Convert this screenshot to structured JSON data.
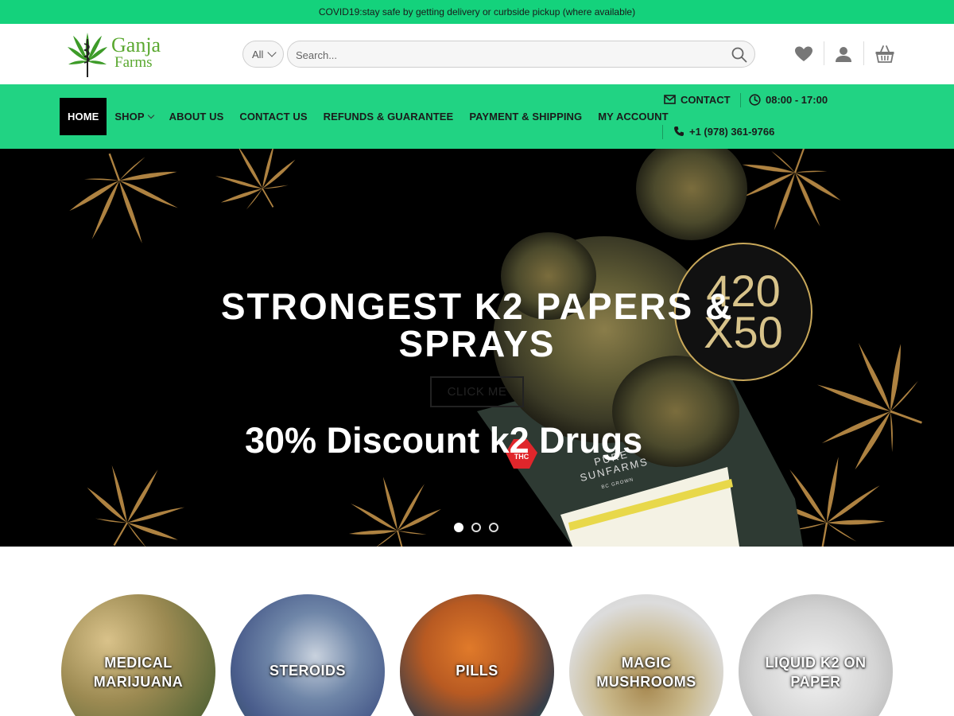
{
  "topbar": {
    "text": "COVID19:stay safe by getting delivery or curbside pickup (where available)"
  },
  "header": {
    "logo": {
      "line1": "Ganja",
      "line2": "Farms"
    },
    "category_select": {
      "value": "All"
    },
    "search": {
      "placeholder": "Search..."
    },
    "icons": [
      "heart-icon",
      "user-icon",
      "basket-icon"
    ]
  },
  "nav": {
    "items": [
      {
        "label": "HOME",
        "active": true
      },
      {
        "label": "SHOP",
        "dropdown": true
      },
      {
        "label": "ABOUT US"
      },
      {
        "label": "CONTACT US"
      },
      {
        "label": "REFUNDS & GUARANTEE"
      },
      {
        "label": "PAYMENT & SHIPPING"
      },
      {
        "label": "MY ACCOUNT"
      }
    ],
    "contact": {
      "label": "CONTACT",
      "hours": "08:00 - 17:00",
      "phone": "+1 (978) 361-9766"
    }
  },
  "hero": {
    "title_line1": "STRONGEST K2 PAPERS &",
    "title_line2": "SPRAYS",
    "button": "CLICK ME",
    "subtitle": "30% Discount k2 Drugs",
    "slides": 3,
    "active_slide": 1,
    "badge": {
      "line1": "420",
      "line2": "X50"
    },
    "pack_text": {
      "line1": "PURE",
      "line2": "SUNFARMS",
      "line3": "BC GROWN",
      "thc": "THC"
    }
  },
  "categories": [
    {
      "line1": "MEDICAL",
      "line2": "MARIJUANA"
    },
    {
      "line1": "STEROIDS"
    },
    {
      "line1": "PILLS"
    },
    {
      "line1": "MAGIC",
      "line2": "MUSHROOMS"
    },
    {
      "line1": "LIQUID K2 ON",
      "line2": "PAPER"
    }
  ],
  "colors": {
    "brand_green": "#14d27c",
    "nav_green": "#21d383",
    "logo_green": "#5aa830"
  }
}
